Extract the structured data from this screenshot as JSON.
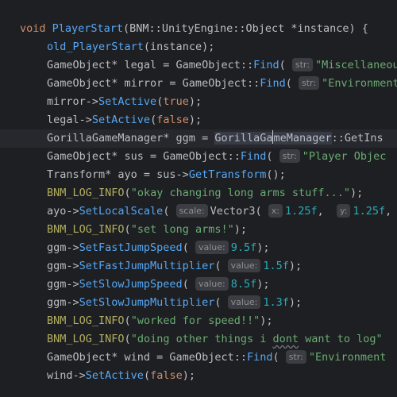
{
  "code": {
    "l1": {
      "kw": "void ",
      "fn": "PlayerStart",
      "rest": "(BNM::UnityEngine::Object *instance) {"
    },
    "l2": {
      "fn": "old_PlayerStart",
      "rest": "(instance);"
    },
    "l3": {
      "a": "GameObject* legal = GameObject::",
      "fn": "Find",
      "b": "( ",
      "hint": "str:",
      "str": "\"Miscellaneous"
    },
    "l4": {
      "a": "GameObject* mirror = GameObject::",
      "fn": "Find",
      "b": "( ",
      "hint": "str:",
      "str": "\"Environment"
    },
    "l5": {
      "a": "mirror->",
      "fn": "SetActive",
      "b": "(",
      "kw": "true",
      "c": ");"
    },
    "l6": {
      "a": "legal->",
      "fn": "SetActive",
      "b": "(",
      "kw": "false",
      "c": ");"
    },
    "l7": {
      "a": "GorillaGameManager* ggm = ",
      "sel1": "GorillaGa",
      "sel2": "meManager",
      "b": "::GetIns"
    },
    "l8": {
      "a": "GameObject* sus = GameObject::",
      "fn": "Find",
      "b": "( ",
      "hint": "str:",
      "str": "\"Player Objec"
    },
    "l9": {
      "a": "Transform* ayo = sus->",
      "fn": "GetTransform",
      "b": "();"
    },
    "l10": {
      "mac": "BNM_LOG_INFO",
      "b": "(",
      "str": "\"okay changing long arms stuff...\"",
      "c": ");"
    },
    "l11": {
      "a": "ayo->",
      "fn": "SetLocalScale",
      "b": "( ",
      "hint1": "scale:",
      "c": "Vector3( ",
      "hint2": "x:",
      "num1": "1.25f",
      "d": ",  ",
      "hint3": "y:",
      "num2": "1.25f",
      "e": ","
    },
    "l12": {
      "mac": "BNM_LOG_INFO",
      "b": "(",
      "str": "\"set long arms!\"",
      "c": ");"
    },
    "l13": {
      "a": "ggm->",
      "fn": "SetFastJumpSpeed",
      "b": "( ",
      "hint": "value:",
      "num": "9.5f",
      "c": ");"
    },
    "l14": {
      "a": "ggm->",
      "fn": "SetFastJumpMultiplier",
      "b": "( ",
      "hint": "value:",
      "num": "1.5f",
      "c": ");"
    },
    "l15": {
      "a": "ggm->",
      "fn": "SetSlowJumpSpeed",
      "b": "( ",
      "hint": "value:",
      "num": "8.5f",
      "c": ");"
    },
    "l16": {
      "a": "ggm->",
      "fn": "SetSlowJumpMultiplier",
      "b": "( ",
      "hint": "value:",
      "num": "1.3f",
      "c": ");"
    },
    "l17": {
      "mac": "BNM_LOG_INFO",
      "b": "(",
      "str": "\"worked for speed!!\"",
      "c": ");"
    },
    "l18": {
      "mac": "BNM_LOG_INFO",
      "b": "(",
      "str1": "\"doing other things i ",
      "sq": "dont",
      "str2": " want to log\""
    },
    "l19": {
      "a": "GameObject* wind = GameObject::",
      "fn": "Find",
      "b": "( ",
      "hint": "str:",
      "str": "\"Environment"
    },
    "l20": {
      "a": "wind->",
      "fn": "SetActive",
      "b": "(",
      "kw": "false",
      "c": ");"
    }
  },
  "icons": {
    "intention": "lightbulb-icon"
  },
  "colors": {
    "background": "#1e1f22",
    "keyword": "#cf8e6d",
    "function": "#56a8f5",
    "string": "#6aab73",
    "number": "#2aacb8",
    "macro": "#b3ae60",
    "text": "#bcbec4",
    "hint_bg": "#3b3d42"
  }
}
